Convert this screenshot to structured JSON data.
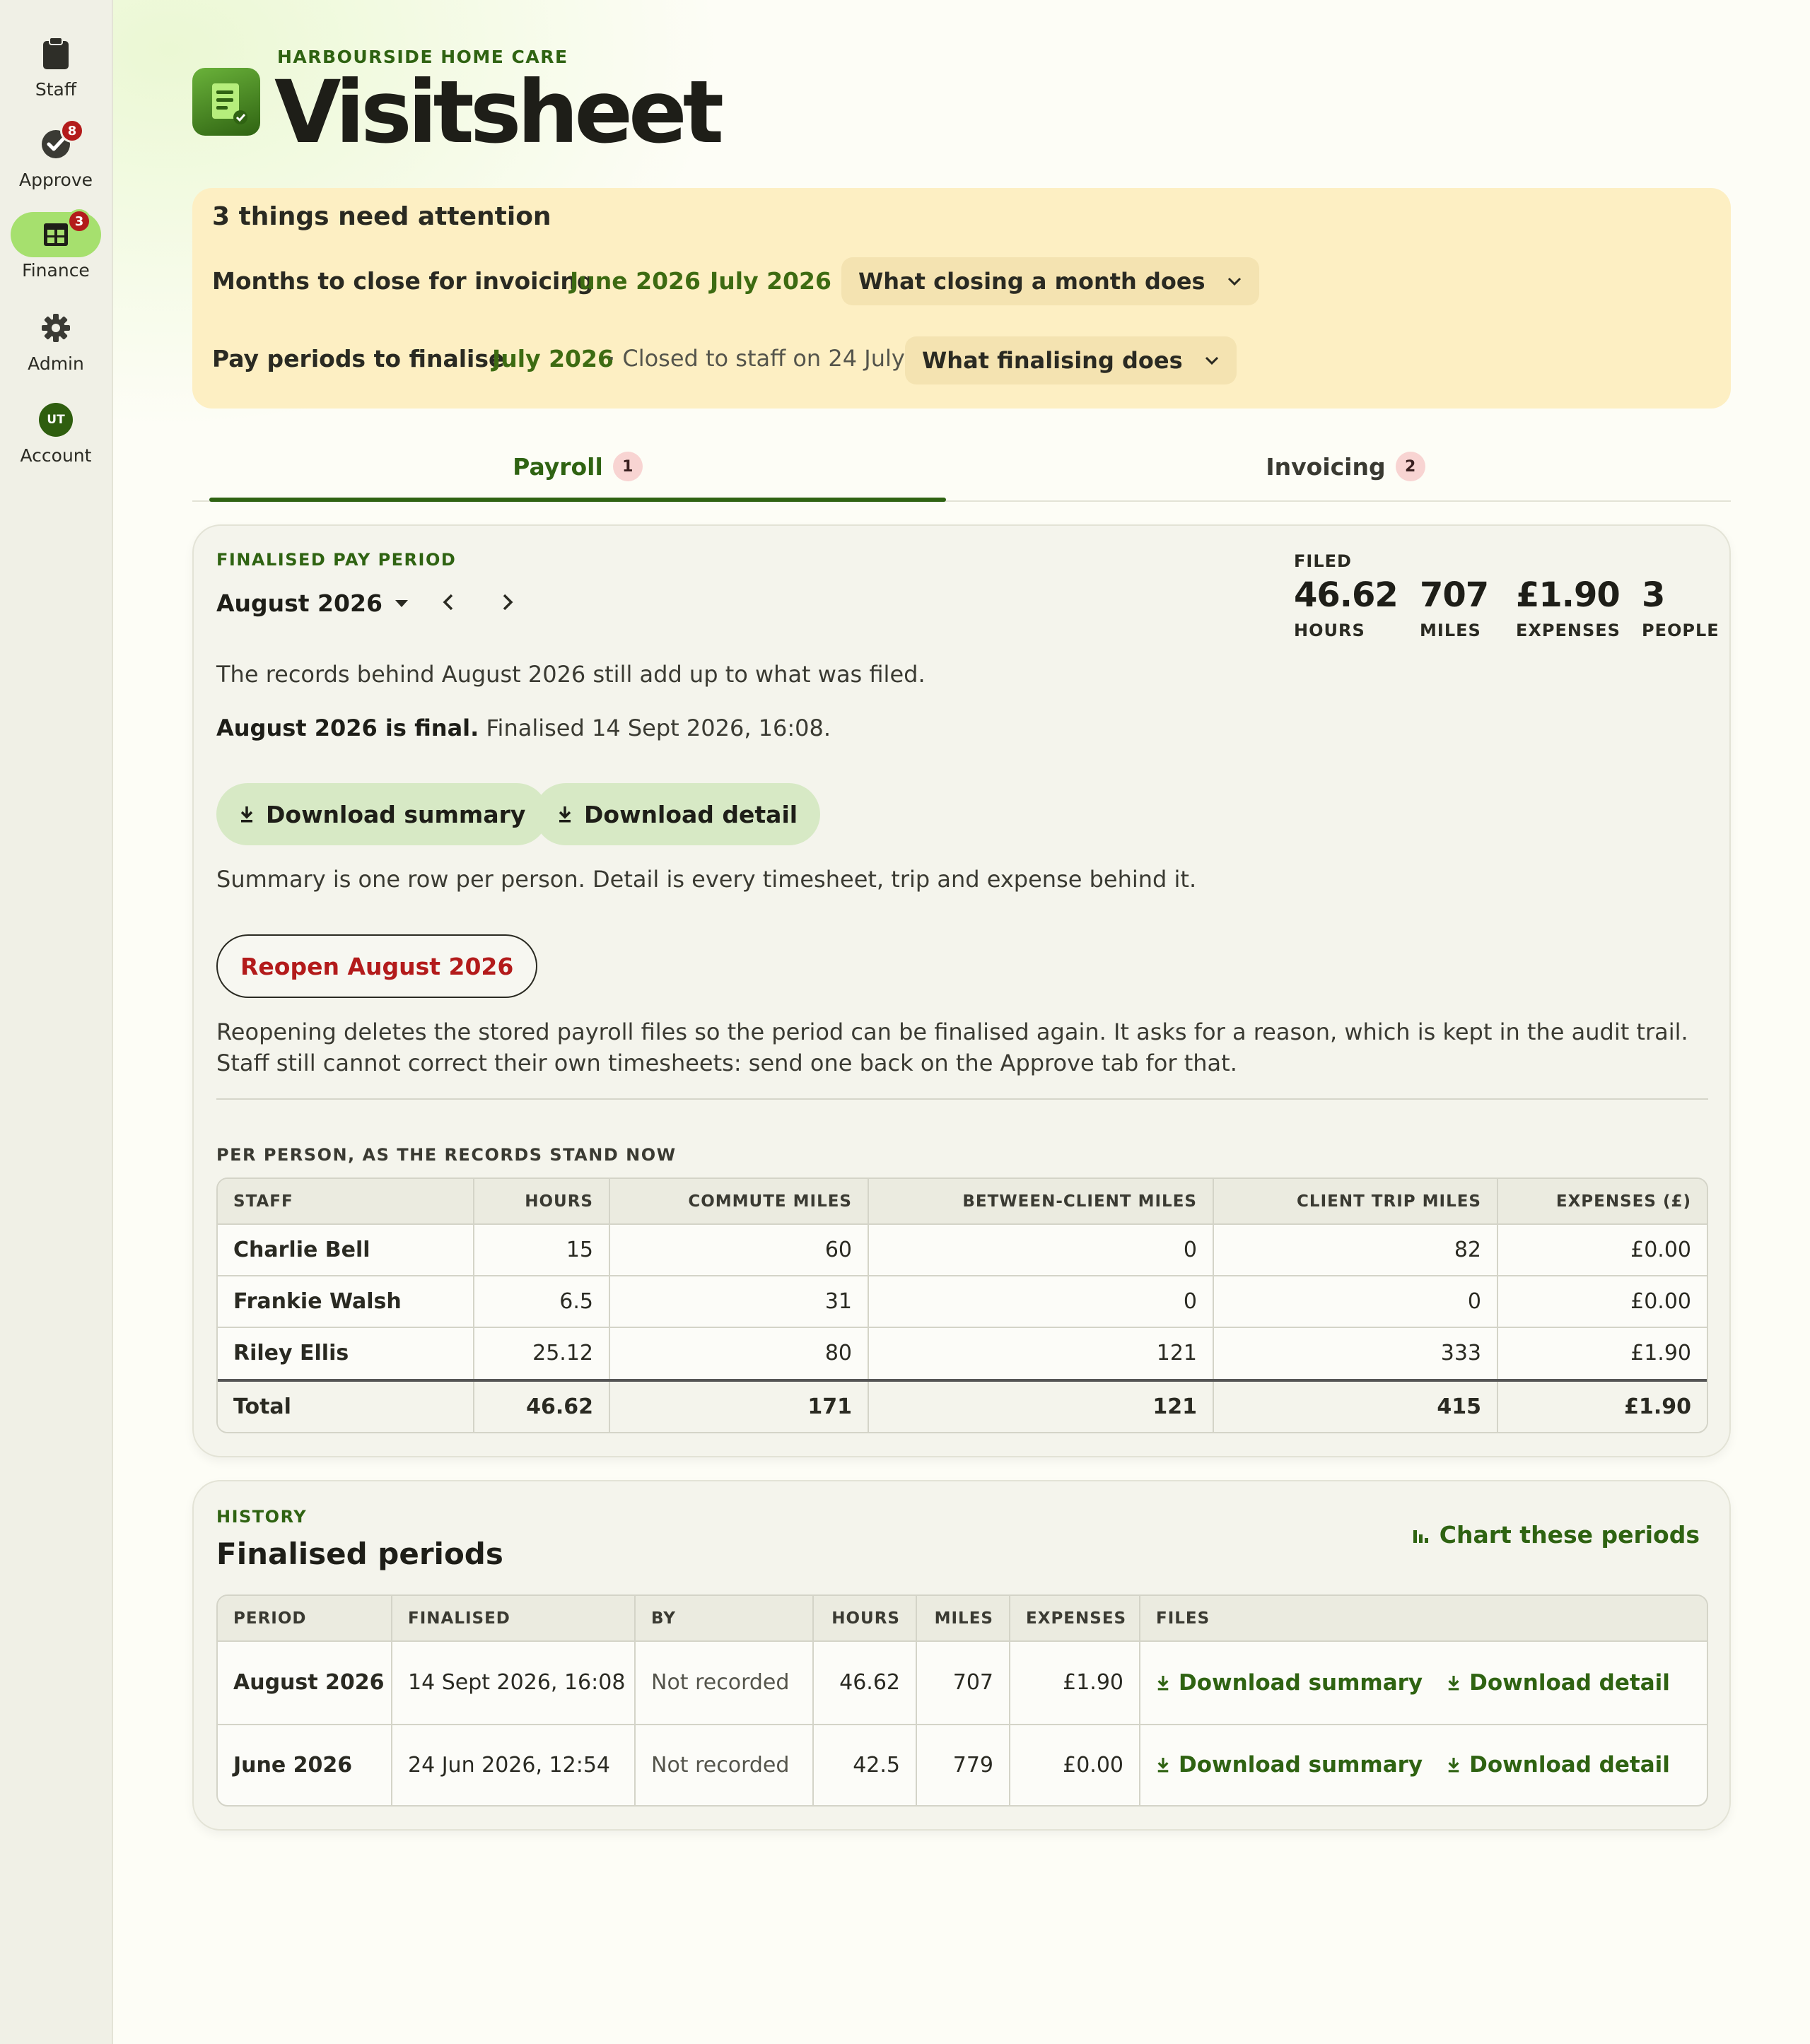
{
  "app": {
    "org": "HARBOURSIDE HOME CARE",
    "title": "Visitsheet"
  },
  "nav": [
    {
      "label": "Staff",
      "icon": "clipboard-icon",
      "badge": ""
    },
    {
      "label": "Approve",
      "icon": "check-circle-icon",
      "badge": "8"
    },
    {
      "label": "Finance",
      "icon": "table-icon",
      "badge": "3",
      "active": true
    },
    {
      "label": "Admin",
      "icon": "gear-icon",
      "badge": ""
    },
    {
      "label": "Account",
      "icon": "avatar",
      "badge": "",
      "initials": "UT"
    }
  ],
  "attention": {
    "title": "3 things need attention",
    "months_label": "Months to close for invoicing",
    "months": [
      "June 2026",
      "July 2026"
    ],
    "months_help": "What closing a month does",
    "pay_label": "Pay periods to finalise",
    "pay_period": "July 2026",
    "pay_note": "· Closed to staff on 24 July",
    "pay_help": "What finalising does"
  },
  "tabs": [
    {
      "label": "Payroll",
      "badge": "1",
      "active": true
    },
    {
      "label": "Invoicing",
      "badge": "2"
    }
  ],
  "period": {
    "eyebrow": "FINALISED PAY PERIOD",
    "selected": "August 2026",
    "filed_label": "FILED",
    "stats": [
      {
        "value": "46.62",
        "label": "HOURS"
      },
      {
        "value": "707",
        "label": "MILES"
      },
      {
        "value": "£1.90",
        "label": "EXPENSES"
      },
      {
        "value": "3",
        "label": "PEOPLE"
      }
    ],
    "integrity": "The records behind August 2026 still add up to what was filed.",
    "final_bold": "August 2026 is final.",
    "final_rest": " Finalised 14 Sept 2026, 16:08.",
    "download_summary": "Download summary",
    "download_detail": "Download detail",
    "download_note": "Summary is one row per person. Detail is every timesheet, trip and expense behind it.",
    "reopen": "Reopen August 2026",
    "reopen_note": "Reopening deletes the stored payroll files so the period can be finalised again. It asks for a reason, which is kept in the audit trail. Staff still cannot correct their own timesheets: send one back on the Approve tab for that."
  },
  "per_person": {
    "eyebrow": "PER PERSON, AS THE RECORDS STAND NOW",
    "columns": [
      "STAFF",
      "HOURS",
      "COMMUTE MILES",
      "BETWEEN-CLIENT MILES",
      "CLIENT TRIP MILES",
      "EXPENSES (£)"
    ],
    "rows": [
      [
        "Charlie Bell",
        "15",
        "60",
        "0",
        "82",
        "£0.00"
      ],
      [
        "Frankie Walsh",
        "6.5",
        "31",
        "0",
        "0",
        "£0.00"
      ],
      [
        "Riley Ellis",
        "25.12",
        "80",
        "121",
        "333",
        "£1.90"
      ]
    ],
    "total": [
      "Total",
      "46.62",
      "171",
      "121",
      "415",
      "£1.90"
    ]
  },
  "history": {
    "eyebrow": "HISTORY",
    "title": "Finalised periods",
    "chart_link": "Chart these periods",
    "columns": [
      "PERIOD",
      "FINALISED",
      "BY",
      "HOURS",
      "MILES",
      "EXPENSES",
      "FILES"
    ],
    "rows": [
      {
        "period": "August 2026",
        "finalised": "14 Sept 2026, 16:08",
        "by": "Not recorded",
        "hours": "46.62",
        "miles": "707",
        "expenses": "£1.90",
        "summary": "Download summary",
        "detail": "Download detail"
      },
      {
        "period": "June 2026",
        "finalised": "24 Jun 2026, 12:54",
        "by": "Not recorded",
        "hours": "42.5",
        "miles": "779",
        "expenses": "£0.00",
        "summary": "Download summary",
        "detail": "Download detail"
      }
    ]
  },
  "colors": {
    "accent": "#2f6312",
    "banner": "#fdefc3",
    "danger": "#b31b1b",
    "nav_active": "#a6e06e"
  }
}
